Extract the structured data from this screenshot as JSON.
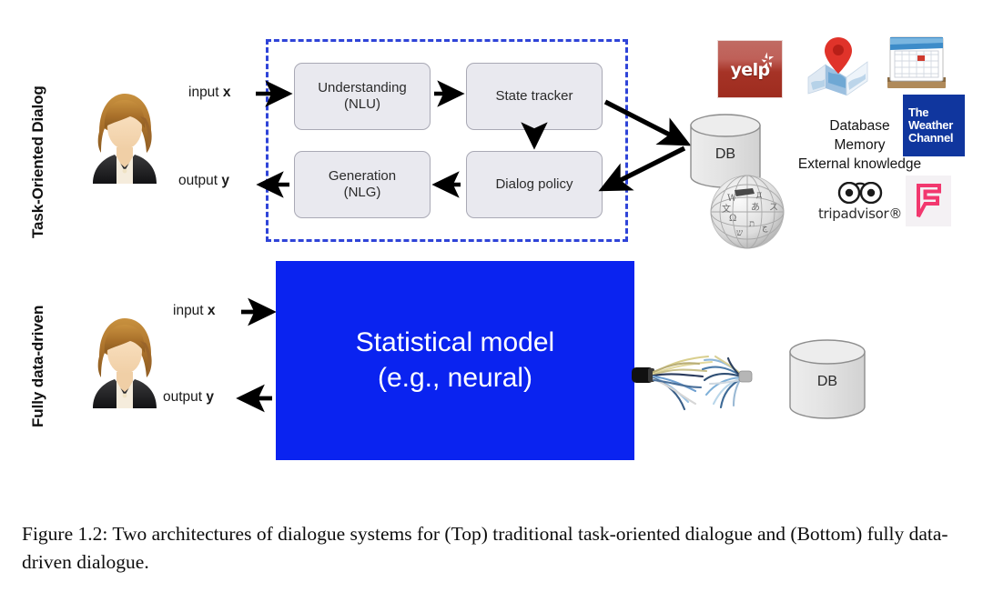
{
  "figure": {
    "caption": "Figure 1.2: Two architectures of dialogue systems for (Top) traditional task-oriented dialogue and (Bottom) fully data-driven dialogue."
  },
  "colors": {
    "dashed_border": "#2f44d8",
    "stat_model_fill": "#0a23f0",
    "pipeline_box_fill": "#e9e9ef",
    "pipeline_box_border": "#a9a9b5",
    "yelp_red": "#a63326",
    "weather_blue": "#10369e",
    "foursquare_pink": "#f2386f",
    "arrow_black": "#000000"
  },
  "top_panel": {
    "row_label": "Task-Oriented Dialog",
    "user_avatar": "user-avatar-icon",
    "input_label_prefix": "input ",
    "input_label_var": "x",
    "output_label_prefix": "output ",
    "output_label_var": "y",
    "boxes": [
      {
        "id": "nlu",
        "line1": "Understanding",
        "line2": "(NLU)"
      },
      {
        "id": "state-tracker",
        "line1": "State tracker",
        "line2": ""
      },
      {
        "id": "dialog-policy",
        "line1": "Dialog policy",
        "line2": ""
      },
      {
        "id": "nlg",
        "line1": "Generation",
        "line2": "(NLG)"
      }
    ],
    "database": {
      "label": "DB"
    },
    "knowledge_lines": [
      "Database",
      "Memory",
      "External knowledge"
    ],
    "logos": [
      {
        "id": "yelp",
        "name": "yelp-logo",
        "text": "yelp"
      },
      {
        "id": "maps",
        "name": "maps-logo",
        "text": ""
      },
      {
        "id": "calendar",
        "name": "calendar-logo",
        "text": ""
      },
      {
        "id": "weather-channel",
        "name": "weather-channel-logo",
        "line1": "The",
        "line2": "Weather",
        "line3": "Channel"
      },
      {
        "id": "wikipedia",
        "name": "wikipedia-globe-logo",
        "text": ""
      },
      {
        "id": "tripadvisor",
        "name": "tripadvisor-logo",
        "text": "tripadvisor®"
      },
      {
        "id": "foursquare",
        "name": "foursquare-logo",
        "text": ""
      }
    ]
  },
  "bottom_panel": {
    "row_label": "Fully data-driven",
    "user_avatar": "user-avatar-icon",
    "input_label_prefix": "input ",
    "input_label_var": "x",
    "output_label_prefix": "output ",
    "output_label_var": "y",
    "model_line1": "Statistical model",
    "model_line2": "(e.g., neural)",
    "database": {
      "label": "DB"
    },
    "connector": "frayed-cable-icon"
  }
}
